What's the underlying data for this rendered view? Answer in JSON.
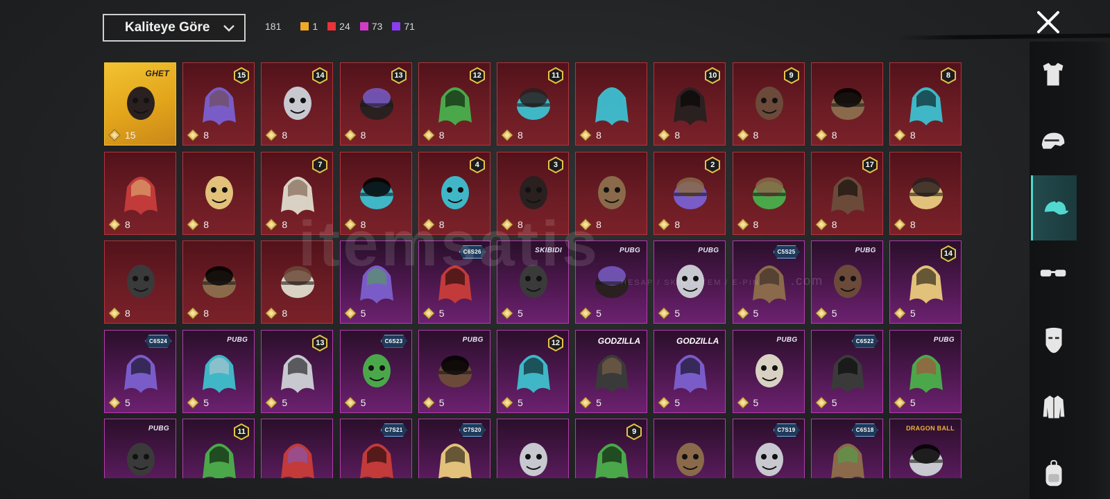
{
  "sort": {
    "label": "Kaliteye Göre",
    "icon": "chevron-down-icon"
  },
  "counts": {
    "total": "181",
    "qualities": [
      {
        "color": "#f0a928",
        "value": "1"
      },
      {
        "color": "#e8333a",
        "value": "24"
      },
      {
        "color": "#d23ac8",
        "value": "73"
      },
      {
        "color": "#8a3cf0",
        "value": "71"
      }
    ]
  },
  "close_icon": "close-icon",
  "watermark": {
    "brand": "itemsatis",
    "sub": "HESAP / SKIN / ITEM / E-PIN",
    "domain": ".com"
  },
  "colors": {
    "legendary": "#f1c232",
    "epic": "#b3353d",
    "rare": "#b93ab0",
    "accent": "#52d9cf"
  },
  "items": [
    {
      "rarity": "gold",
      "price": "15",
      "tag": "GHET",
      "tag_type": "brand",
      "art": "masked-figure-icon"
    },
    {
      "rarity": "red",
      "price": "8",
      "level": "15",
      "art": "blonde-hair-icon"
    },
    {
      "rarity": "red",
      "price": "8",
      "level": "14",
      "art": "horse-mask-icon"
    },
    {
      "rarity": "red",
      "price": "8",
      "level": "13",
      "art": "hat-with-hair-icon"
    },
    {
      "rarity": "red",
      "price": "8",
      "level": "12",
      "art": "white-hair-icon"
    },
    {
      "rarity": "red",
      "price": "8",
      "level": "11",
      "art": "black-helmet-icon"
    },
    {
      "rarity": "red",
      "price": "8",
      "art": "ghost-hair-icon"
    },
    {
      "rarity": "red",
      "price": "8",
      "level": "10",
      "art": "brown-hair-icon"
    },
    {
      "rarity": "red",
      "price": "8",
      "level": "9",
      "art": "zombie-head-icon"
    },
    {
      "rarity": "red",
      "price": "8",
      "art": "cowboy-hat-icon"
    },
    {
      "rarity": "red",
      "price": "8",
      "level": "8",
      "art": "silver-hair-icon"
    },
    {
      "rarity": "red",
      "price": "8",
      "art": "purple-jellyfish-icon"
    },
    {
      "rarity": "red",
      "price": "8",
      "art": "demon-mask-icon"
    },
    {
      "rarity": "red",
      "price": "8",
      "level": "7",
      "art": "long-white-hair-icon"
    },
    {
      "rarity": "red",
      "price": "8",
      "art": "red-helmet-icon"
    },
    {
      "rarity": "red",
      "price": "8",
      "level": "4",
      "art": "snowman-head-icon"
    },
    {
      "rarity": "red",
      "price": "8",
      "level": "3",
      "art": "clown-head-icon"
    },
    {
      "rarity": "red",
      "price": "8",
      "art": "green-crown-mask-icon"
    },
    {
      "rarity": "red",
      "price": "8",
      "level": "2",
      "art": "blue-bucket-hat-icon"
    },
    {
      "rarity": "red",
      "price": "8",
      "art": "oni-helmet-icon"
    },
    {
      "rarity": "red",
      "price": "8",
      "level": "17",
      "art": "feather-hair-icon"
    },
    {
      "rarity": "red",
      "price": "8",
      "art": "cyber-helmet-icon"
    },
    {
      "rarity": "red",
      "price": "8",
      "art": "green-alien-mask-icon"
    },
    {
      "rarity": "red",
      "price": "8",
      "art": "dark-knight-helmet-icon"
    },
    {
      "rarity": "red",
      "price": "8",
      "art": "pirate-hat-icon"
    },
    {
      "rarity": "purple",
      "price": "5",
      "art": "messy-hair-icon"
    },
    {
      "rarity": "purple",
      "price": "5",
      "tag": "C6S26",
      "tag_type": "season",
      "art": "gold-creature-icon"
    },
    {
      "rarity": "purple",
      "price": "5",
      "tag": "SKIBIDI",
      "tag_type": "pubg",
      "art": "camera-head-icon"
    },
    {
      "rarity": "purple",
      "price": "5",
      "tag": "PUBG",
      "tag_type": "pubg",
      "art": "fedora-hat-icon"
    },
    {
      "rarity": "purple",
      "price": "5",
      "tag": "PUBG",
      "tag_type": "pubg",
      "art": "bunny-headband-icon"
    },
    {
      "rarity": "purple",
      "price": "5",
      "tag": "C5S25",
      "tag_type": "season",
      "art": "grey-hair-icon"
    },
    {
      "rarity": "purple",
      "price": "5",
      "tag": "PUBG",
      "tag_type": "pubg",
      "art": "yellow-box-head-icon"
    },
    {
      "rarity": "purple",
      "price": "5",
      "level": "14",
      "art": "flower-hair-icon"
    },
    {
      "rarity": "purple",
      "price": "5",
      "tag": "C6S24",
      "tag_type": "season",
      "art": "bob-hair-icon"
    },
    {
      "rarity": "purple",
      "price": "5",
      "tag": "PUBG",
      "tag_type": "pubg",
      "art": "ribbon-hair-icon"
    },
    {
      "rarity": "purple",
      "price": "5",
      "level": "13",
      "art": "aviator-goggles-icon"
    },
    {
      "rarity": "purple",
      "price": "5",
      "tag": "C6S23",
      "tag_type": "season",
      "art": "cat-headphones-icon"
    },
    {
      "rarity": "purple",
      "price": "5",
      "tag": "PUBG",
      "tag_type": "pubg",
      "art": "cap-with-glasses-icon"
    },
    {
      "rarity": "purple",
      "price": "5",
      "level": "12",
      "art": "orange-hair-icon"
    },
    {
      "rarity": "purple",
      "price": "5",
      "tag": "GODZILLA",
      "tag_type": "godzilla",
      "art": "blue-hair-icon"
    },
    {
      "rarity": "purple",
      "price": "5",
      "tag": "GODZILLA",
      "tag_type": "godzilla",
      "art": "spiky-hair-glasses-icon"
    },
    {
      "rarity": "purple",
      "price": "5",
      "tag": "PUBG",
      "tag_type": "pubg",
      "art": "bull-head-icon"
    },
    {
      "rarity": "purple",
      "price": "5",
      "tag": "C6S22",
      "tag_type": "season",
      "art": "purple-hair-icon"
    },
    {
      "rarity": "purple",
      "price": "5",
      "tag": "PUBG",
      "tag_type": "pubg",
      "art": "red-hair-icon"
    },
    {
      "rarity": "purple",
      "price": "",
      "tag": "PUBG",
      "tag_type": "pubg",
      "art": "panda-head-icon"
    },
    {
      "rarity": "purple",
      "price": "",
      "level": "11",
      "art": "flower-veil-icon"
    },
    {
      "rarity": "purple",
      "price": "",
      "art": "ponytail-icon"
    },
    {
      "rarity": "purple",
      "price": "",
      "tag": "C7S21",
      "tag_type": "season",
      "art": "silver-wave-hair-icon"
    },
    {
      "rarity": "purple",
      "price": "",
      "tag": "C7S20",
      "tag_type": "season",
      "art": "green-hair-icon"
    },
    {
      "rarity": "purple",
      "price": "",
      "art": "pumpkin-head-icon"
    },
    {
      "rarity": "purple",
      "price": "",
      "level": "9",
      "art": "dark-long-hair-icon"
    },
    {
      "rarity": "purple",
      "price": "",
      "art": "red-cat-mask-icon"
    },
    {
      "rarity": "purple",
      "price": "",
      "tag": "C7S19",
      "tag_type": "season",
      "art": "feather-headdress-icon"
    },
    {
      "rarity": "purple",
      "price": "",
      "tag": "C6S18",
      "tag_type": "season",
      "art": "brown-short-hair-icon"
    },
    {
      "rarity": "purple",
      "price": "",
      "tag": "DRAGON BALL",
      "tag_type": "dragon",
      "art": "green-cap-hair-icon"
    }
  ],
  "side_tabs": [
    {
      "icon": "outfit-icon",
      "active": false
    },
    {
      "icon": "helmet-icon",
      "active": false
    },
    {
      "icon": "cap-icon",
      "active": true
    },
    {
      "icon": "glasses-icon",
      "active": false
    },
    {
      "icon": "mask-icon",
      "active": false
    },
    {
      "icon": "jacket-icon",
      "active": false
    },
    {
      "icon": "backpack-icon",
      "active": false
    }
  ]
}
